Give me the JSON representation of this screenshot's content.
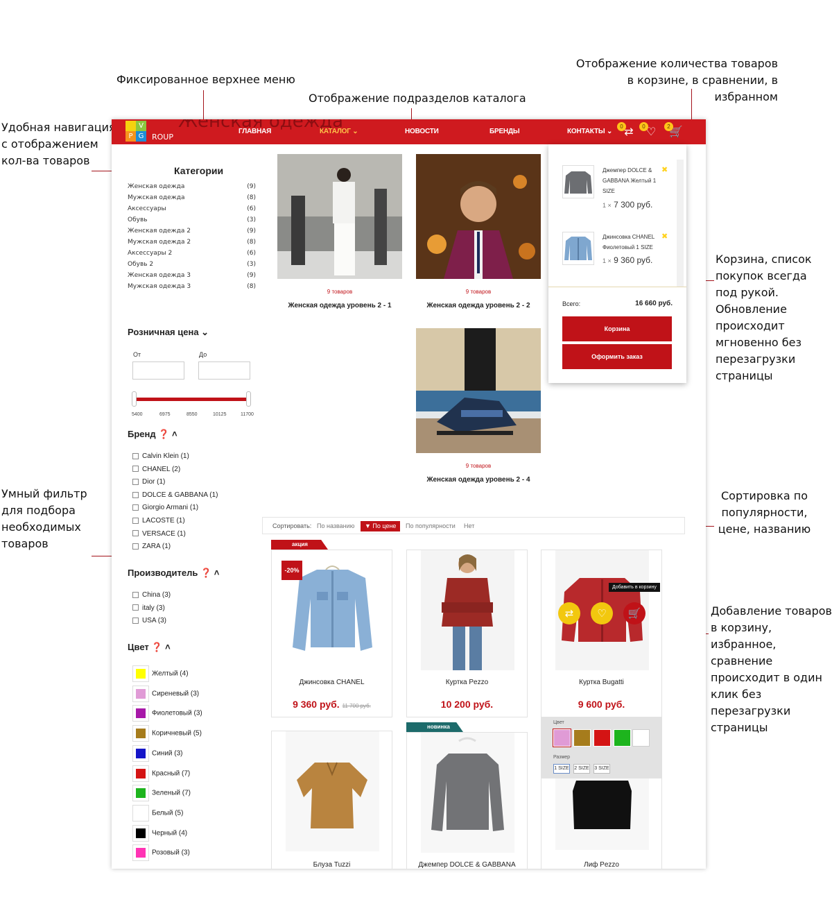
{
  "annotations": {
    "top_menu": "Фиксированное верхнее меню",
    "subsections": "Отображение подразделов каталога",
    "counts_line1": "Отображение количества товаров",
    "counts_line2": "в корзине, в сравнении, в избранном",
    "nav_line1": "Удобная навигация",
    "nav_line2": "с отображением",
    "nav_line3": "кол-ва товаров",
    "cart_lines": [
      "Корзина, список",
      "покупок всегда",
      "под рукой.",
      "Обновление",
      "происходит",
      "мгновенно без",
      "перезагрузки",
      "страницы"
    ],
    "filter_lines": [
      "Умный фильтр",
      "для подбора",
      "необходимых",
      "товаров"
    ],
    "sort_lines": [
      "Сортировка по",
      "популярности,",
      "цене, названию"
    ],
    "add_lines": [
      "Добавление товаров",
      "в корзину,",
      "избранное,",
      "сравнение",
      "происходит в один",
      "клик без",
      "перезагрузки",
      "страницы"
    ]
  },
  "header": {
    "ghost_title": "Женская одежда",
    "logo": {
      "letters": [
        "V",
        "P",
        "G"
      ],
      "text": "ROUP"
    },
    "nav": [
      "Главная",
      "Каталог",
      "Новости",
      "Бренды",
      "Контакты"
    ],
    "badges": {
      "compare": "0",
      "favorites": "0",
      "cart": "2"
    }
  },
  "sidebar": {
    "categories_title": "Категории",
    "categories": [
      {
        "name": "Женская одежда",
        "count": "(9)"
      },
      {
        "name": "Мужская одежда",
        "count": "(8)"
      },
      {
        "name": "Аксессуары",
        "count": "(6)"
      },
      {
        "name": "Обувь",
        "count": "(3)"
      },
      {
        "name": "Женская одежда 2",
        "count": "(9)"
      },
      {
        "name": "Мужская одежда 2",
        "count": "(8)"
      },
      {
        "name": "Аксессуары 2",
        "count": "(6)"
      },
      {
        "name": "Обувь 2",
        "count": "(3)"
      },
      {
        "name": "Женская одежда 3",
        "count": "(9)"
      },
      {
        "name": "Мужская одежда 3",
        "count": "(8)"
      }
    ],
    "price_title": "Розничная цена",
    "price_from": "От",
    "price_to": "До",
    "price_ticks": [
      "5400",
      "6975",
      "8550",
      "10125",
      "11700"
    ],
    "brand_title": "Бренд",
    "brands": [
      "Calvin Klein (1)",
      "CHANEL (2)",
      "Dior (1)",
      "DOLCE & GABBANA (1)",
      "Giorgio Armani (1)",
      "LACOSTE (1)",
      "VERSACE (1)",
      "ZARA (1)"
    ],
    "maker_title": "Производитель",
    "makers": [
      "China (3)",
      "italy (3)",
      "USA (3)"
    ],
    "color_title": "Цвет",
    "colors": [
      {
        "name": "Желтый (4)",
        "hex": "#ffff00"
      },
      {
        "name": "Сиреневый (3)",
        "hex": "#e09bd6"
      },
      {
        "name": "Фиолетовый (3)",
        "hex": "#a718a8"
      },
      {
        "name": "Коричневый (5)",
        "hex": "#a67c1c"
      },
      {
        "name": "Синий (3)",
        "hex": "#1515c8"
      },
      {
        "name": "Красный (7)",
        "hex": "#d41414"
      },
      {
        "name": "Зеленый (7)",
        "hex": "#1db41d"
      },
      {
        "name": "Белый (5)",
        "hex": "#ffffff"
      },
      {
        "name": "Черный (4)",
        "hex": "#000000"
      },
      {
        "name": "Розовый (3)",
        "hex": "#ff33b4"
      }
    ]
  },
  "subsections": [
    {
      "count": "9 товаров",
      "name": "Женская одежда уровень 2 - 1"
    },
    {
      "count": "9 товаров",
      "name": "Женская одежда уровень 2 - 2"
    },
    {
      "count": "9 товаров",
      "name": "Женская одежда уровень 2 - 4"
    }
  ],
  "cart_popup": {
    "items": [
      {
        "name": "Джемпер DOLCE & GABBANA Желтый 1 SIZE",
        "qty": "1 ×",
        "price": "7 300 руб."
      },
      {
        "name": "Джинсовка CHANEL Фиолетовый 1 SIZE",
        "qty": "1 ×",
        "price": "9 360 руб."
      }
    ],
    "total_label": "Всего:",
    "total_value": "16 660 руб.",
    "cart_button": "Корзина",
    "checkout_button": "Оформить заказ"
  },
  "sort": {
    "label": "Сортировать:",
    "options": [
      "По названию",
      "По цене",
      "По популярности",
      "Нет"
    ],
    "active": "По цене"
  },
  "products": [
    {
      "name": "Джинсовка CHANEL",
      "price": "9 360 руб.",
      "old_price": "11 700 руб.",
      "ribbon": "акция",
      "discount": "-20%"
    },
    {
      "name": "Куртка Pezzo",
      "price": "10 200 руб."
    },
    {
      "name": "Куртка Bugatti",
      "price": "9 600 руб.",
      "tooltip": "Добавить в корзину"
    },
    {
      "name": "Блуза Tuzzi"
    },
    {
      "name": "Джемпер DOLCE & GABBANA",
      "ribbon": "новинка"
    },
    {
      "name": "Лиф Pezzo"
    }
  ],
  "options_panel": {
    "color_label": "Цвет",
    "size_label": "Размер",
    "colors": [
      "#e09bd6",
      "#a67c1c",
      "#d41414",
      "#1db41d",
      "#ffffff"
    ],
    "sizes": [
      "1 SIZE",
      "2 SIZE",
      "3 SIZE"
    ]
  },
  "theme": {
    "accent": "#cf1a1f",
    "badge": "#ffc41a",
    "new_ribbon": "#1d6b6b"
  }
}
